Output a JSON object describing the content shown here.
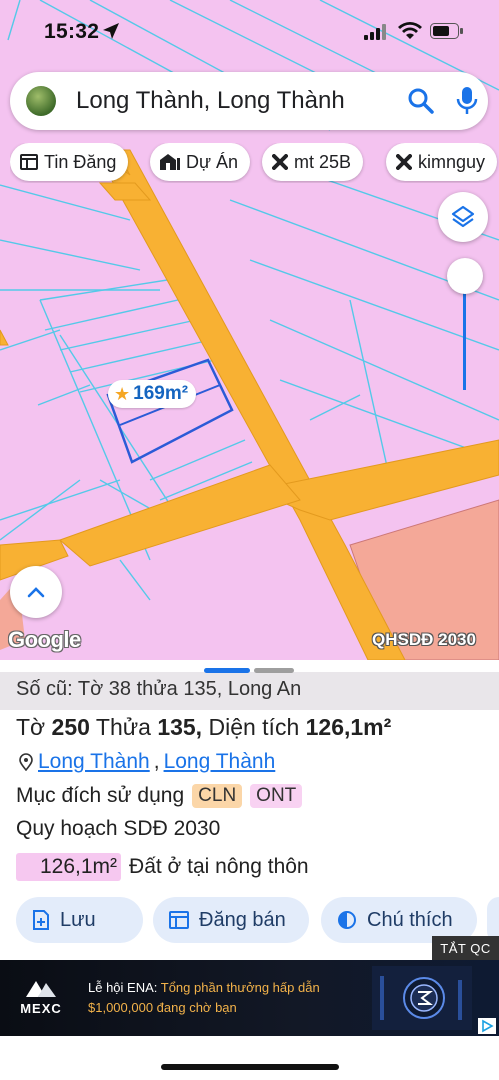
{
  "status_bar": {
    "time": "15:32",
    "icons": [
      "location-arrow-icon",
      "cellular-signal-icon",
      "wifi-icon",
      "battery-icon"
    ]
  },
  "search": {
    "query": "Long Thành, Long Thành",
    "icons": [
      "search-icon",
      "microphone-icon"
    ]
  },
  "chips": [
    {
      "label": "Tin Đăng",
      "icon": "news-icon"
    },
    {
      "label": "Dự Án",
      "icon": "building-icon"
    },
    {
      "label": "mt 25B",
      "icon": "ruler-icon"
    },
    {
      "label": "kimnguy",
      "icon": "ruler-icon"
    }
  ],
  "map": {
    "area_badge": "169m²",
    "attribution": "Google",
    "overlay_label": "QHSDĐ 2030",
    "colors": {
      "land": "#f4c3f0",
      "road": "#f8b133",
      "lot_line": "#54c9e8",
      "selected_lot": "#2b5bd7",
      "zone": "#f4a898"
    }
  },
  "sheet": {
    "old_ref": "Số cũ: Tờ 38 thửa 135, Long An",
    "title": {
      "to_label": "Tờ",
      "to_value": "250",
      "thua_label": "Thửa",
      "thua_value": "135,",
      "area_label": "Diện tích",
      "area_value": "126,1m²"
    },
    "address": {
      "part1": "Long Thành",
      "separator": ",",
      "part2": "Long Thành"
    },
    "purpose": {
      "label": "Mục đích sử dụng",
      "tags": [
        "CLN",
        "ONT"
      ]
    },
    "plan_label": "Quy hoạch SDĐ 2030",
    "zone": {
      "area": "126,1m²",
      "description": "Đất ở tại nông thôn"
    },
    "actions": [
      {
        "label": "Lưu",
        "icon": "save-icon"
      },
      {
        "label": "Đăng bán",
        "icon": "listing-icon"
      },
      {
        "label": "Chú thích",
        "icon": "legend-icon"
      }
    ]
  },
  "ad": {
    "close_label": "TẮT QC",
    "brand": "MEXC",
    "line1_prefix": "Lễ hội ENA:",
    "line1_highlight": "Tổng phần thưởng hấp dẫn",
    "line2": "$1,000,000 đang chờ bạn"
  }
}
